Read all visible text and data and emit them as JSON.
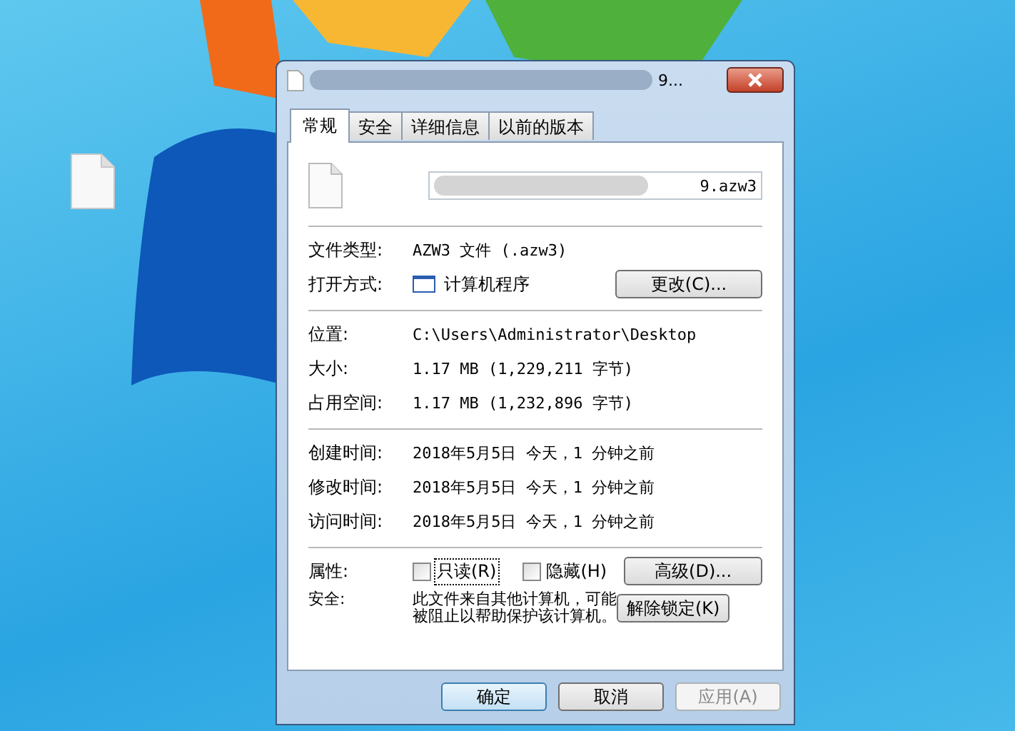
{
  "window": {
    "title": "9..."
  },
  "tabs": [
    {
      "label": "常规",
      "selected": true
    },
    {
      "label": "安全",
      "selected": false
    },
    {
      "label": "详细信息",
      "selected": false
    },
    {
      "label": "以前的版本",
      "selected": false
    }
  ],
  "header": {
    "file_name": "9.azw3"
  },
  "sections": [
    {
      "rows": [
        {
          "kind": "text",
          "label": "文件类型:",
          "value": "AZW3 文件 (.azw3)"
        },
        {
          "kind": "app",
          "label": "打开方式:",
          "value": "计算机程序",
          "button": "更改(C)..."
        }
      ]
    },
    {
      "rows": [
        {
          "kind": "text",
          "label": "位置:",
          "value": "C:\\Users\\Administrator\\Desktop"
        },
        {
          "kind": "text",
          "label": "大小:",
          "value": "1.17 MB (1,229,211 字节)"
        },
        {
          "kind": "text",
          "label": "占用空间:",
          "value": "1.17 MB (1,232,896 字节)"
        }
      ]
    },
    {
      "rows": [
        {
          "kind": "text",
          "label": "创建时间:",
          "value": "2018年5月5日 今天，1 分钟之前"
        },
        {
          "kind": "text",
          "label": "修改时间:",
          "value": "2018年5月5日 今天，1 分钟之前"
        },
        {
          "kind": "text",
          "label": "访问时间:",
          "value": "2018年5月5日 今天，1 分钟之前"
        }
      ]
    },
    {
      "rows": [
        {
          "kind": "checkboxes",
          "label": "属性:",
          "options": [
            {
              "label": "只读(R)",
              "checked": false,
              "focused": true
            },
            {
              "label": "隐藏(H)",
              "checked": false,
              "focused": false
            }
          ],
          "button": "高级(D)..."
        },
        {
          "kind": "note",
          "label": "安全:",
          "value": "此文件来自其他计算机，可能被阻止以帮助保护该计算机。",
          "button": "解除锁定(K)"
        }
      ]
    }
  ],
  "buttons": [
    {
      "label": "确定",
      "default": true,
      "disabled": false
    },
    {
      "label": "取消",
      "default": false,
      "disabled": false
    },
    {
      "label": "应用(A)",
      "default": false,
      "disabled": true
    }
  ]
}
